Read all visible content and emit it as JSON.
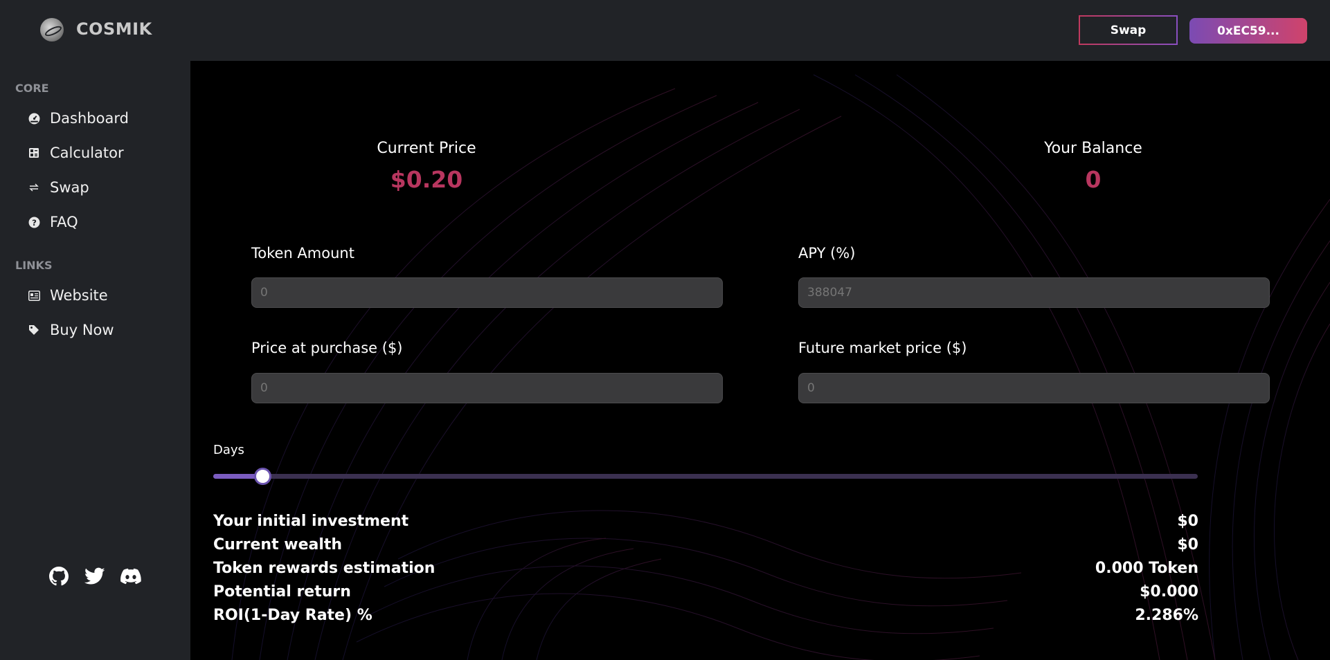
{
  "header": {
    "brand": "COSMIK",
    "swap_label": "Swap",
    "wallet_label": "0xEC59..."
  },
  "sidebar": {
    "core_title": "CORE",
    "core_items": [
      {
        "label": "Dashboard",
        "icon": "gauge-icon"
      },
      {
        "label": "Calculator",
        "icon": "calculator-icon"
      },
      {
        "label": "Swap",
        "icon": "swap-arrows-icon"
      },
      {
        "label": "FAQ",
        "icon": "question-circle-icon"
      }
    ],
    "links_title": "LINKS",
    "link_items": [
      {
        "label": "Website",
        "icon": "newspaper-icon"
      },
      {
        "label": "Buy Now",
        "icon": "tag-icon"
      }
    ],
    "social": [
      "github-icon",
      "twitter-icon",
      "discord-icon"
    ]
  },
  "stats": {
    "current_price_label": "Current Price",
    "current_price_value": "$0.20",
    "balance_label": "Your Balance",
    "balance_value": "0"
  },
  "form": {
    "token_amount_label": "Token Amount",
    "token_amount_placeholder": "0",
    "apy_label": "APY (%)",
    "apy_placeholder": "388047",
    "purchase_price_label": "Price at purchase ($)",
    "purchase_price_placeholder": "0",
    "future_price_label": "Future market price ($)",
    "future_price_placeholder": "0",
    "days_label": "Days",
    "days_fraction": 0.05
  },
  "results": [
    {
      "label": "Your initial investment",
      "value": "$0"
    },
    {
      "label": "Current wealth",
      "value": "$0"
    },
    {
      "label": "Token rewards estimation",
      "value": "0.000 Token"
    },
    {
      "label": "Potential return",
      "value": "$0.000"
    },
    {
      "label": "ROI(1-Day Rate) %",
      "value": "2.286%"
    }
  ],
  "colors": {
    "accent": "#b8365f",
    "slider": "#7b5cc0",
    "sidebar_bg": "#212327"
  }
}
